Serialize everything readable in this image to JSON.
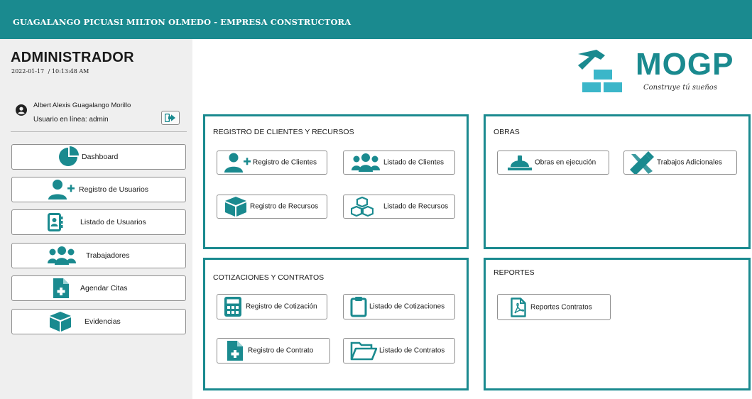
{
  "header": {
    "title": "GUAGALANGO PICUASI MILTON OLMEDO - EMPRESA CONSTRUCTORA"
  },
  "colors": {
    "accent": "#1a8a8f",
    "sidebar_bg": "#efefef",
    "icon": "#1a8a8f"
  },
  "sidebar": {
    "role": "ADMINISTRADOR",
    "date": "2022-01-17",
    "separator": "/",
    "time": "10:13:48 AM",
    "user_name": "Albert Alexis Guagalango Morillo",
    "user_online": "Usuario en línea: admin",
    "items": [
      {
        "label": "Dashboard",
        "icon": "pie-chart-icon"
      },
      {
        "label": "Registro de Usuarios",
        "icon": "user-plus-icon"
      },
      {
        "label": "Listado de Usuarios",
        "icon": "address-book-icon"
      },
      {
        "label": "Trabajadores",
        "icon": "users-icon"
      },
      {
        "label": "Agendar Citas",
        "icon": "file-medical-icon"
      },
      {
        "label": "Evidencias",
        "icon": "box-icon"
      }
    ]
  },
  "logo": {
    "word": "MOGP",
    "tagline": "Construye tú sueños"
  },
  "panels": {
    "clientes": {
      "title": "REGISTRO DE CLIENTES Y RECURSOS",
      "buttons": [
        "Registro de Clientes",
        "Listado de Clientes",
        "Registro de Recursos",
        "Listado de Recursos"
      ]
    },
    "obras": {
      "title": "OBRAS",
      "buttons": [
        "Obras en ejecución",
        "Trabajos Adicionales"
      ]
    },
    "cotizaciones": {
      "title": "COTIZACIONES Y CONTRATOS",
      "buttons": [
        "Registro de Cotización",
        "Listado de Cotizaciones",
        "Registro de Contrato",
        "Listado de Contratos"
      ]
    },
    "reportes": {
      "title": "REPORTES",
      "buttons": [
        "Reportes Contratos"
      ]
    }
  }
}
